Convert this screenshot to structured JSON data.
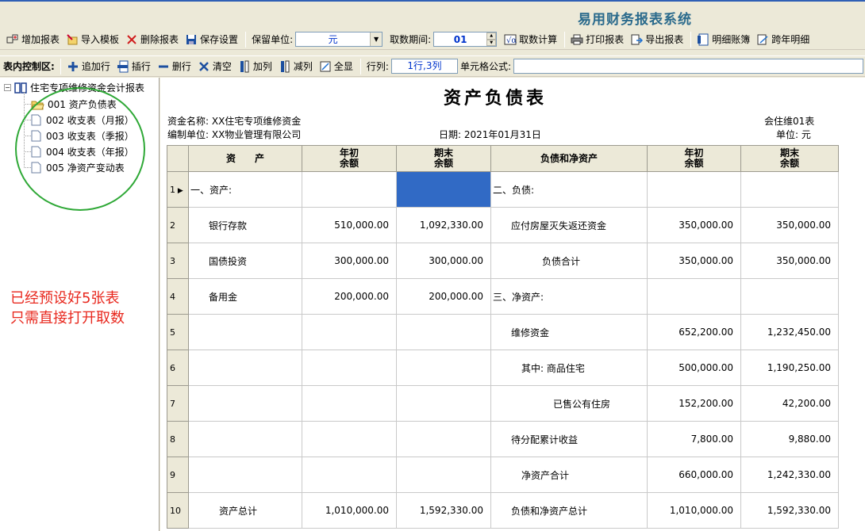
{
  "app_title": "易用财务报表系统",
  "toolbar1": {
    "add_report": "增加报表",
    "import_template": "导入模板",
    "delete_report": "删除报表",
    "save_settings": "保存设置",
    "keep_unit_label": "保留单位:",
    "keep_unit_value": "元",
    "period_label": "取数期间:",
    "period_value": "01",
    "calc": "取数计算",
    "print": "打印报表",
    "export": "导出报表",
    "detail_ledger": "明细账簿",
    "cross_year": "跨年明细"
  },
  "toolbar2": {
    "area_label": "表内控制区:",
    "append_row": "追加行",
    "insert_row": "插行",
    "delete_row": "删行",
    "clear": "清空",
    "add_col": "加列",
    "remove_col": "减列",
    "show_all": "全显",
    "rowcol_label": "行列:",
    "rowcol_value": "1行,3列",
    "formula_label": "单元格公式:",
    "formula_value": ""
  },
  "tree": {
    "root": "住宅专项维修资金会计报表",
    "items": [
      {
        "label": "001 资产负债表",
        "icon": "open-folder-icon"
      },
      {
        "label": "002 收支表（月报）",
        "icon": "document-icon"
      },
      {
        "label": "003 收支表（季报）",
        "icon": "document-icon"
      },
      {
        "label": "004 收支表（年报）",
        "icon": "document-icon"
      },
      {
        "label": "005 净资产变动表",
        "icon": "document-icon"
      }
    ]
  },
  "annotation": {
    "line1": "已经预设好5张表",
    "line2": "只需直接打开取数"
  },
  "report": {
    "title": "资产负债表",
    "fund_name": "资金名称: XX住宅专项维修资金",
    "compiler": "编制单位: XX物业管理有限公司",
    "date": "日期: 2021年01月31日",
    "form_no": "会住维01表",
    "unit": "单位: 元",
    "headers": [
      "资　　产",
      "年初\n余额",
      "期末\n余额",
      "负债和净资产",
      "年初\n余额",
      "期末\n余额"
    ],
    "rows": [
      {
        "n": "1",
        "current": true,
        "a": "一、资产:",
        "a_indent": 0,
        "b": "",
        "c": "",
        "d": "二、负债:",
        "d_indent": 0,
        "e": "",
        "f": ""
      },
      {
        "n": "2",
        "a": "银行存款",
        "a_indent": 1,
        "b": "510,000.00",
        "c": "1,092,330.00",
        "d": "应付房屋灭失返还资金",
        "d_indent": 1,
        "e": "350,000.00",
        "f": "350,000.00"
      },
      {
        "n": "3",
        "a": "国债投资",
        "a_indent": 1,
        "b": "300,000.00",
        "c": "300,000.00",
        "d": "负债合计",
        "d_indent": 3,
        "e": "350,000.00",
        "f": "350,000.00"
      },
      {
        "n": "4",
        "a": "备用金",
        "a_indent": 1,
        "b": "200,000.00",
        "c": "200,000.00",
        "d": "三、净资产:",
        "d_indent": 0,
        "e": "",
        "f": ""
      },
      {
        "n": "5",
        "a": "",
        "a_indent": 0,
        "b": "",
        "c": "",
        "d": "维修资金",
        "d_indent": 1,
        "e": "652,200.00",
        "f": "1,232,450.00"
      },
      {
        "n": "6",
        "a": "",
        "a_indent": 0,
        "b": "",
        "c": "",
        "d": "其中: 商品住宅",
        "d_indent": 2,
        "e": "500,000.00",
        "f": "1,190,250.00"
      },
      {
        "n": "7",
        "a": "",
        "a_indent": 0,
        "b": "",
        "c": "",
        "d": "已售公有住房",
        "d_indent": 4,
        "e": "152,200.00",
        "f": "42,200.00"
      },
      {
        "n": "8",
        "a": "",
        "a_indent": 0,
        "b": "",
        "c": "",
        "d": "待分配累计收益",
        "d_indent": 1,
        "e": "7,800.00",
        "f": "9,880.00"
      },
      {
        "n": "9",
        "a": "",
        "a_indent": 0,
        "b": "",
        "c": "",
        "d": "净资产合计",
        "d_indent": 2,
        "e": "660,000.00",
        "f": "1,242,330.00"
      },
      {
        "n": "10",
        "a": "资产总计",
        "a_indent": 2,
        "b": "1,010,000.00",
        "c": "1,592,330.00",
        "d": "负债和净资产总计",
        "d_indent": 1,
        "e": "1,010,000.00",
        "f": "1,592,330.00"
      }
    ],
    "selected_cell": {
      "row": 1,
      "col": 3
    }
  },
  "colors": {
    "title": "#2a6a8c",
    "selection": "#316ac5",
    "annotation": "#e8281e",
    "circle": "#2ea836"
  }
}
